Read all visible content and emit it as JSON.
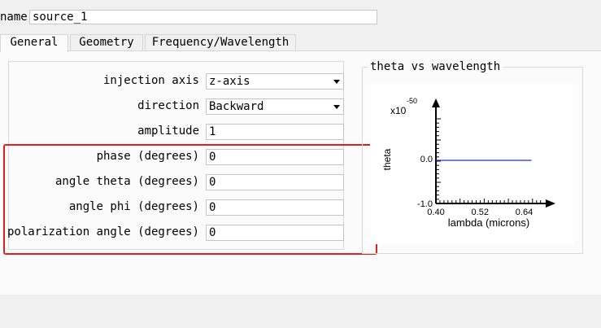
{
  "header": {
    "name_label": "name",
    "name_value": "source_1"
  },
  "tabs": [
    {
      "label": "General",
      "active": true
    },
    {
      "label": "Geometry",
      "active": false
    },
    {
      "label": "Frequency/Wavelength",
      "active": false
    }
  ],
  "form": {
    "injection_axis": {
      "label": "injection axis",
      "value": "z-axis"
    },
    "direction": {
      "label": "direction",
      "value": "Backward"
    },
    "amplitude": {
      "label": "amplitude",
      "value": "1"
    },
    "phase": {
      "label": "phase (degrees)",
      "value": "0"
    },
    "angle_theta": {
      "label": "angle theta (degrees)",
      "value": "0"
    },
    "angle_phi": {
      "label": "angle phi (degrees)",
      "value": "0"
    },
    "polarization_angle": {
      "label": "polarization angle (degrees)",
      "value": "0"
    }
  },
  "colors": {
    "highlight": "#e02020",
    "series": "#2030c0"
  },
  "chart_data": {
    "type": "line",
    "title": "theta vs wavelength",
    "xlabel": "lambda (microns)",
    "ylabel": "theta",
    "y_multiplier": "x10",
    "y_exponent": "-50",
    "x_ticks": [
      "0.40",
      "0.52",
      "0.64"
    ],
    "y_ticks": [
      "-1.0",
      "0.0"
    ],
    "xlim": [
      0.4,
      0.7
    ],
    "ylim": [
      -1.0,
      1.0
    ],
    "series": [
      {
        "x": [
          0.4,
          0.66
        ],
        "y": [
          0.0,
          0.0
        ]
      }
    ]
  }
}
